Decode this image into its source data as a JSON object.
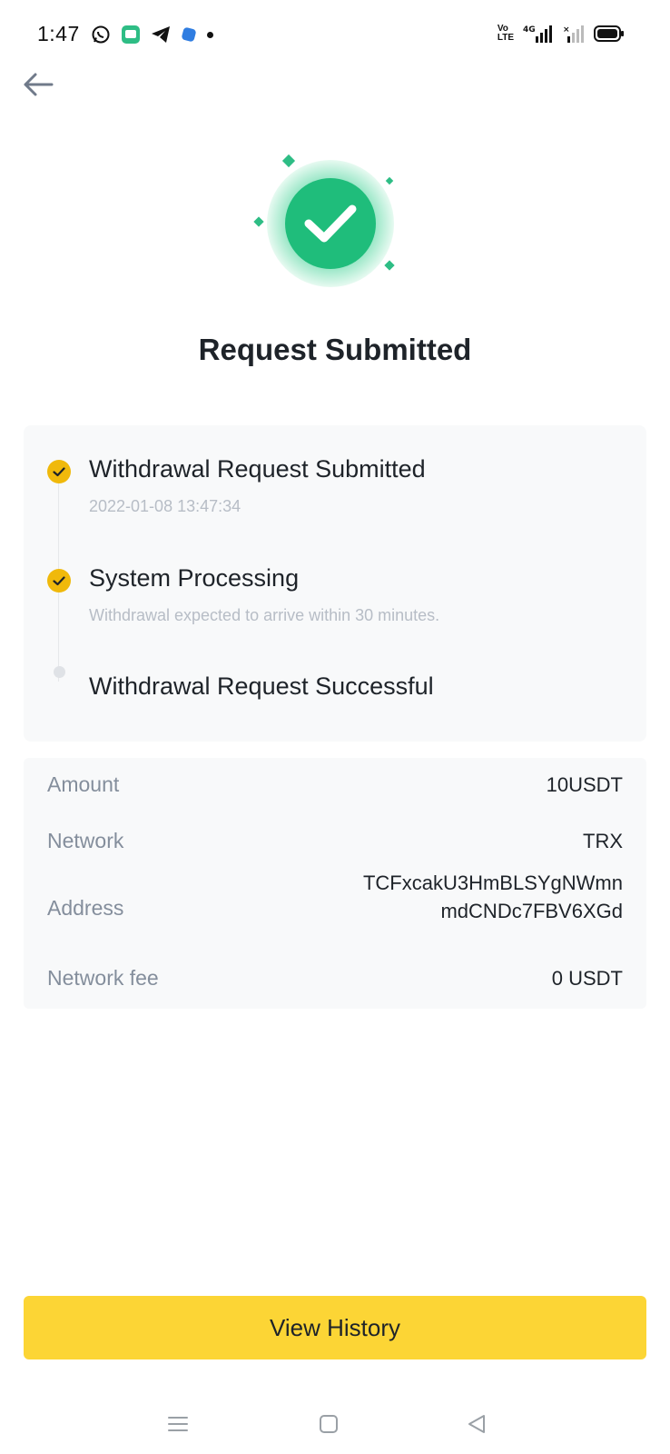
{
  "status_bar": {
    "time": "1:47",
    "left_icons": [
      "whatsapp-icon",
      "message-app-icon",
      "telegram-icon",
      "app-icon",
      "notification-dot-icon"
    ],
    "network_label": "Vo LTE",
    "signal_label": "4G"
  },
  "page": {
    "title": "Request Submitted"
  },
  "timeline": [
    {
      "title": "Withdrawal Request Submitted",
      "subtitle": "2022-01-08 13:47:34",
      "state": "done"
    },
    {
      "title": "System Processing",
      "subtitle": "Withdrawal expected to arrive within 30 minutes.",
      "state": "done"
    },
    {
      "title": "Withdrawal Request Successful",
      "subtitle": "",
      "state": "pending"
    }
  ],
  "details": [
    {
      "label": "Amount",
      "value": "10USDT"
    },
    {
      "label": "Network",
      "value": "TRX"
    },
    {
      "label": "Address",
      "value_line1": "TCFxcakU3HmBLSYgNWmn",
      "value_line2": "mdCNDc7FBV6XGd"
    },
    {
      "label": "Network fee",
      "value": "0 USDT"
    }
  ],
  "actions": {
    "view_history": "View History"
  },
  "colors": {
    "accent_yellow": "#FCD535",
    "step_done": "#F0B90B",
    "success_green": "#2EBD85",
    "text_primary": "#1E2329",
    "text_secondary": "#848E9C",
    "card_bg": "#F8F9FA"
  },
  "nav": [
    "menu-icon",
    "home-square-icon",
    "back-triangle-icon"
  ]
}
